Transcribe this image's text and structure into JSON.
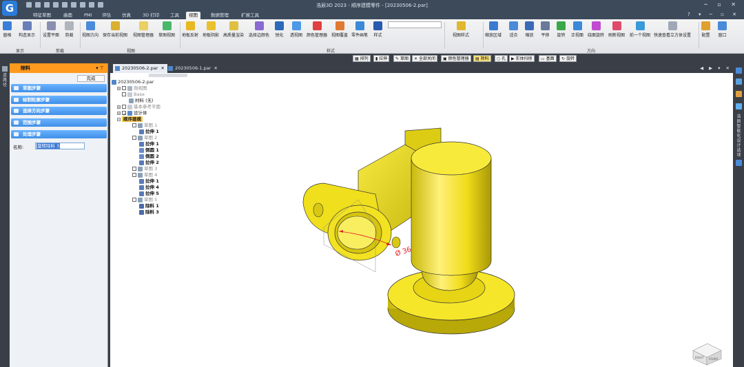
{
  "window": {
    "title": "浩辰3D 2023 - 顺序建模零件 - [20230506-2.par]",
    "logo_glyph": "G"
  },
  "menubar": {
    "tabs": [
      {
        "label": "特征草图"
      },
      {
        "label": "曲面"
      },
      {
        "label": "PMI"
      },
      {
        "label": "评估"
      },
      {
        "label": "仿真"
      },
      {
        "label": "3D 打印"
      },
      {
        "label": "工具"
      },
      {
        "label": "视图"
      },
      {
        "label": "数据管理"
      },
      {
        "label": "扩展工具"
      }
    ],
    "active_tab": "视图",
    "help_glyph": "?"
  },
  "ribbon": {
    "buttons": [
      {
        "label": "窗格",
        "color": "#3c7fd8"
      },
      {
        "label": "构造显示",
        "color": "#6a7fb8"
      },
      {
        "label": "设置平面",
        "color": "#8a8fb0"
      },
      {
        "label": "剪裁",
        "color": "#b0b4bc"
      },
      {
        "label": "视图方向",
        "color": "#4a8ad8"
      },
      {
        "label": "保存当前视图",
        "color": "#d9b030"
      },
      {
        "label": "视图管理器",
        "color": "#e9d060"
      },
      {
        "label": "草图视图",
        "color": "#4ab86a"
      },
      {
        "label": "地板反射",
        "color": "#e8b820"
      },
      {
        "label": "地板阴影",
        "color": "#e8c030"
      },
      {
        "label": "高质量渲染",
        "color": "#e0c040"
      },
      {
        "label": "选择边颜色",
        "color": "#8a6ad0"
      },
      {
        "label": "锐化",
        "color": "#2a6ab8"
      },
      {
        "label": "透视图",
        "color": "#4a9ae8"
      },
      {
        "label": "颜色管理器",
        "color": "#e04040"
      },
      {
        "label": "视图覆盖",
        "color": "#e07a30"
      },
      {
        "label": "零件画笔",
        "color": "#3a8ad8"
      },
      {
        "label": "样式",
        "color": "#2a5ab0"
      },
      {
        "label": "视图样式",
        "color": "#e0b830"
      },
      {
        "label": "缩放区域",
        "color": "#3a7ad0"
      },
      {
        "label": "适合",
        "color": "#4a8ad8"
      },
      {
        "label": "缩放",
        "color": "#3a6ab8"
      },
      {
        "label": "平移",
        "color": "#6a7a9a"
      },
      {
        "label": "旋转",
        "color": "#3aa84a"
      },
      {
        "label": "正视面",
        "color": "#3a8ad8"
      },
      {
        "label": "绕面旋转",
        "color": "#c04ad0"
      },
      {
        "label": "刷新视图",
        "color": "#e04a6a"
      },
      {
        "label": "前一个视图",
        "color": "#3a9ad8"
      },
      {
        "label": "快速查看立方体设置",
        "color": "#a0a8b8"
      },
      {
        "label": "配置",
        "color": "#e0a030"
      },
      {
        "label": "窗口",
        "color": "#4a8ad8"
      }
    ],
    "groups": [
      {
        "label": "显示"
      },
      {
        "label": "剪裁"
      },
      {
        "label": "视图"
      },
      {
        "label": "样式"
      },
      {
        "label": "方向"
      }
    ]
  },
  "command_bar": {
    "items": [
      {
        "label": "排列"
      },
      {
        "label": "拉伸"
      },
      {
        "label": "草图"
      },
      {
        "label": "全部关闭"
      },
      {
        "label": "颜色管理器"
      },
      {
        "label": "除料"
      },
      {
        "label": "孔"
      },
      {
        "label": "实体扫掠"
      },
      {
        "label": "基面"
      },
      {
        "label": "旋转"
      }
    ],
    "active": "除料"
  },
  "left_strip": {
    "vertical_label": "道路径"
  },
  "panel": {
    "title": "除料",
    "pin_glyph": "▾ ⊤",
    "done_label": "完成",
    "steps": [
      {
        "label": "草图步骤"
      },
      {
        "label": "绘制轮廓步骤"
      },
      {
        "label": "选择方向步骤"
      },
      {
        "label": "范围步骤"
      },
      {
        "label": "处理步骤"
      }
    ],
    "name_label": "名称:",
    "name_value": "旋转除料 3"
  },
  "doc_tabs": {
    "tabs": [
      {
        "label": "20230506-2.par",
        "close": "✕",
        "active": true
      },
      {
        "label": "20230506-1.par",
        "close": "✕",
        "active": false
      }
    ],
    "nav_glyphs": "◀ ▶ ▾ ✕"
  },
  "tree": {
    "items": [
      {
        "label": "20230506-2.par",
        "style": ""
      },
      {
        "label": "剖视图",
        "style": "dim"
      },
      {
        "label": "Base",
        "style": "dim"
      },
      {
        "label": "材料 (无)",
        "style": ""
      },
      {
        "label": "基本参考平面",
        "style": "dim"
      },
      {
        "label": "设计体",
        "style": ""
      },
      {
        "label": "顺序建模",
        "style": "sel"
      },
      {
        "label": "草图 1",
        "style": "dim"
      },
      {
        "label": "拉伸 1",
        "style": "bold"
      },
      {
        "label": "草图 2",
        "style": "dim"
      },
      {
        "label": "拉伸 1",
        "style": "bold"
      },
      {
        "label": "倒圆 1",
        "style": "bold"
      },
      {
        "label": "倒圆 2",
        "style": "bold"
      },
      {
        "label": "拉伸 2",
        "style": "bold"
      },
      {
        "label": "草图 3",
        "style": "dim"
      },
      {
        "label": "草图 4",
        "style": "dim"
      },
      {
        "label": "拉伸 1",
        "style": "bold"
      },
      {
        "label": "拉伸 4",
        "style": "bold"
      },
      {
        "label": "拉伸 5",
        "style": "bold"
      },
      {
        "label": "草图 5",
        "style": "dim"
      },
      {
        "label": "除料 1",
        "style": "bold"
      },
      {
        "label": "除料 3",
        "style": "bold"
      }
    ]
  },
  "viewport": {
    "dimension_label": "Ø 36",
    "model_color": "#f4e41c",
    "dimension_color": "#e52020",
    "cube_faces": {
      "right": "RIGHT",
      "front": "FRONT"
    }
  },
  "right_strip": {
    "vertical_label": "浩辰智能化设计选项"
  }
}
